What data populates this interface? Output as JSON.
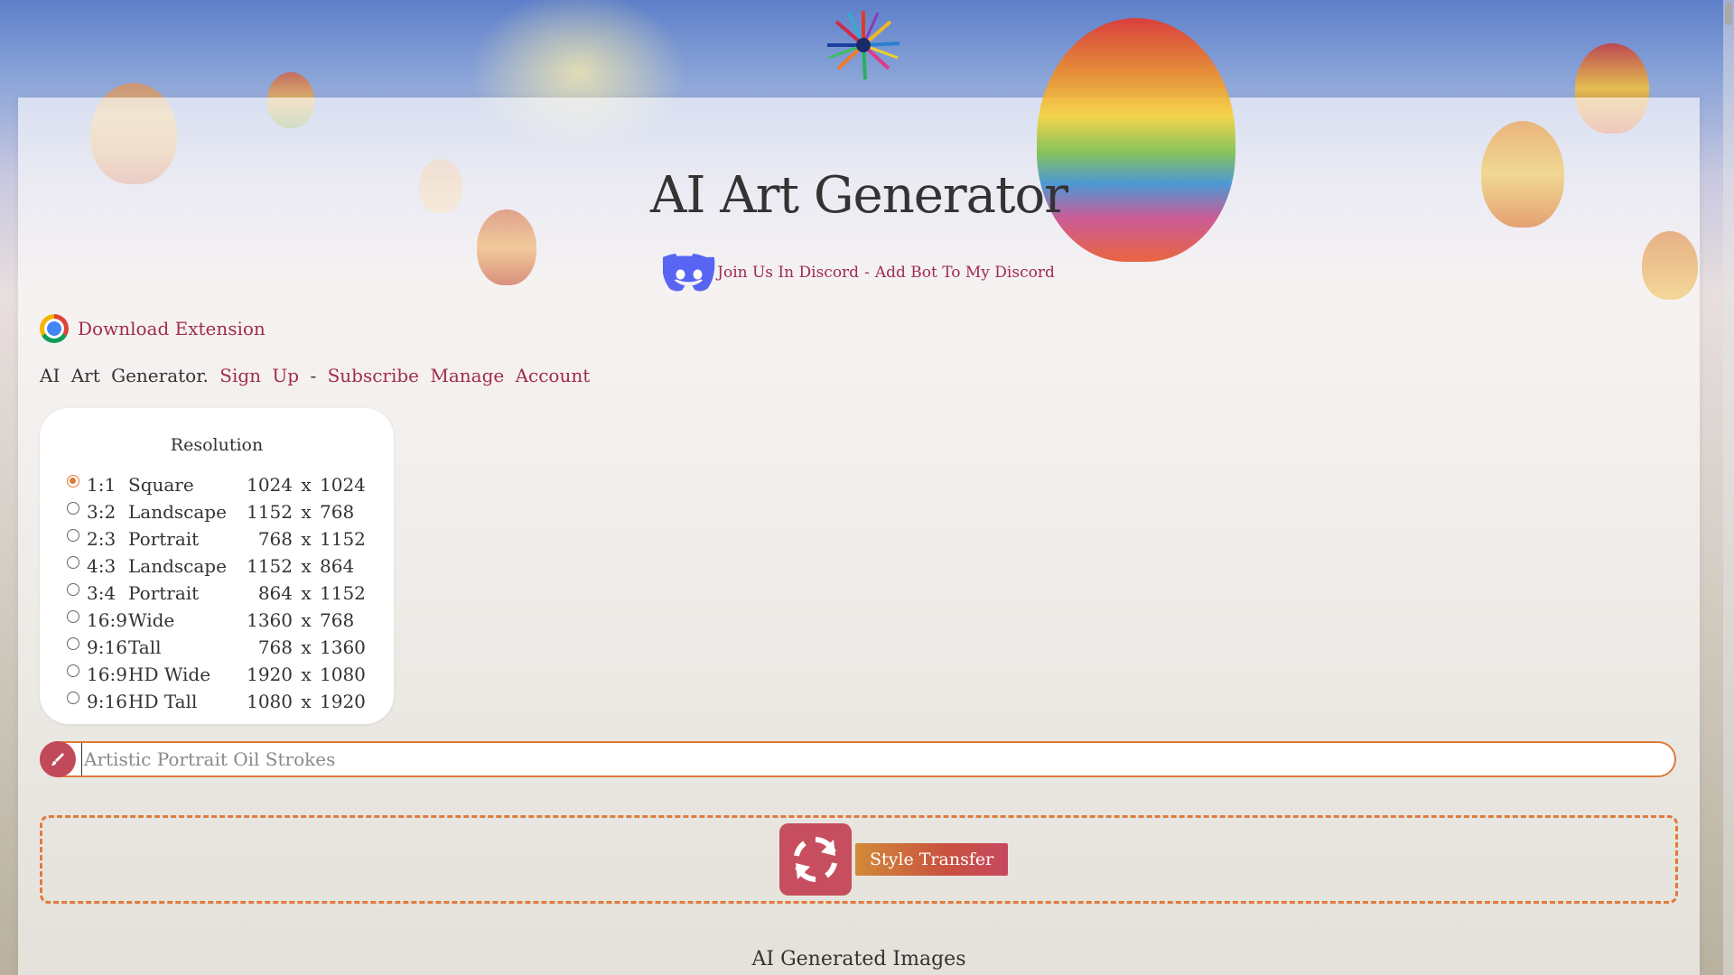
{
  "page": {
    "title": "AI Art Generator"
  },
  "discord": {
    "join_label": "Join Us In Discord",
    "separator": "-",
    "add_bot_label": "Add Bot To My Discord"
  },
  "extension": {
    "label": "Download Extension"
  },
  "account_links": {
    "brand_text": "AI Art Generator.",
    "sign_up": "Sign Up",
    "separator": "-",
    "subscribe": "Subscribe",
    "manage_account": "Manage Account"
  },
  "resolution": {
    "title": "Resolution",
    "selected_index": 0,
    "options": [
      {
        "ratio": "1:1",
        "name": "Square",
        "w": "1024",
        "x": "x",
        "h": "1024"
      },
      {
        "ratio": "3:2",
        "name": "Landscape",
        "w": "1152",
        "x": "x",
        "h": "768"
      },
      {
        "ratio": "2:3",
        "name": "Portrait",
        "w": "768",
        "x": "x",
        "h": "1152"
      },
      {
        "ratio": "4:3",
        "name": "Landscape",
        "w": "1152",
        "x": "x",
        "h": "864"
      },
      {
        "ratio": "3:4",
        "name": "Portrait",
        "w": "864",
        "x": "x",
        "h": "1152"
      },
      {
        "ratio": "16:9",
        "name": "Wide",
        "w": "1360",
        "x": "x",
        "h": "768"
      },
      {
        "ratio": "9:16",
        "name": "Tall",
        "w": "768",
        "x": "x",
        "h": "1360"
      },
      {
        "ratio": "16:9",
        "name": "HD Wide",
        "w": "1920",
        "x": "x",
        "h": "1080"
      },
      {
        "ratio": "9:16",
        "name": "HD Tall",
        "w": "1080",
        "x": "x",
        "h": "1920"
      }
    ]
  },
  "prompt": {
    "placeholder": "Artistic Portrait Oil Strokes"
  },
  "style_transfer": {
    "button_label": "Style Transfer"
  },
  "generated": {
    "title": "AI Generated Images"
  },
  "colors": {
    "accent": "#e07a3a",
    "link": "#a02c50",
    "button": "#c64e5e"
  }
}
